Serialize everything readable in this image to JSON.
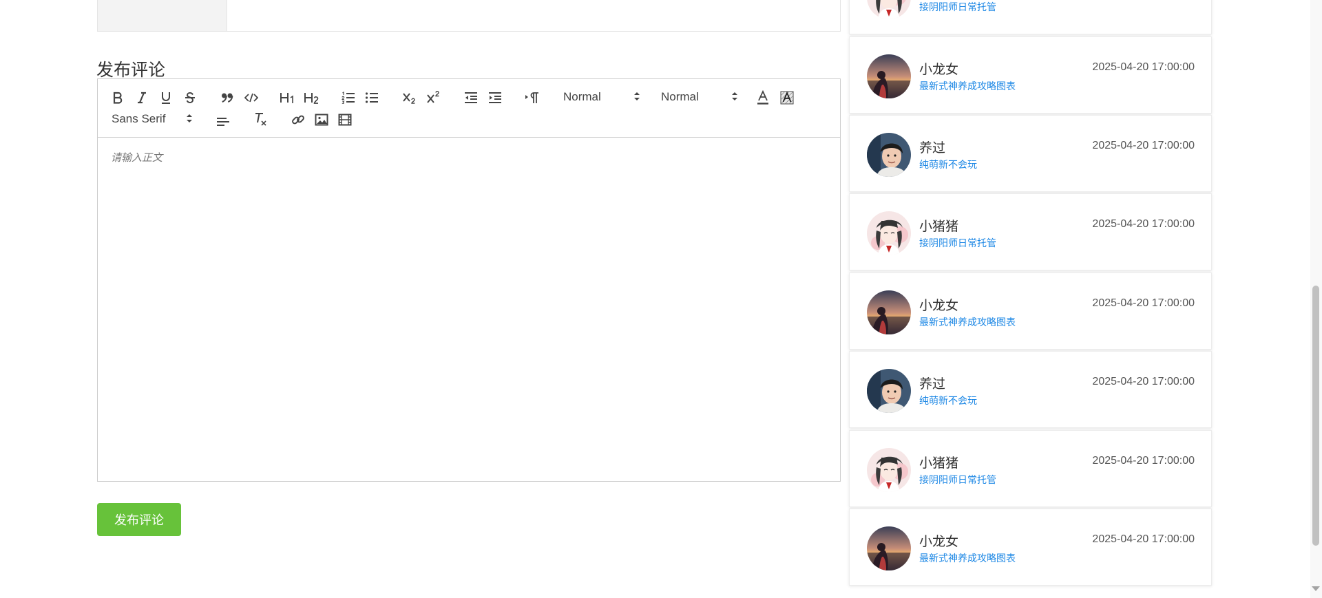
{
  "comment_section": {
    "title": "发布评论",
    "placeholder": "请输入正文",
    "submit_label": "发布评论",
    "toolbar": {
      "header_picker": "Normal",
      "size_picker": "Normal",
      "font_picker": "Sans Serif"
    }
  },
  "sidebar": {
    "partial_item": {
      "game": "接阴阳师日常托管",
      "avatar_icon": "anime-girl-avatar"
    },
    "items": [
      {
        "name": "小龙女",
        "game": "最新式神养成攻略图表",
        "time": "2025-04-20 17:00:00",
        "avatar_icon": "sunset-avatar"
      },
      {
        "name": "养过",
        "game": "纯萌新不会玩",
        "time": "2025-04-20 17:00:00",
        "avatar_icon": "man-avatar"
      },
      {
        "name": "小猪猪",
        "game": "接阴阳师日常托管",
        "time": "2025-04-20 17:00:00",
        "avatar_icon": "anime-girl-avatar"
      },
      {
        "name": "小龙女",
        "game": "最新式神养成攻略图表",
        "time": "2025-04-20 17:00:00",
        "avatar_icon": "sunset-avatar"
      },
      {
        "name": "养过",
        "game": "纯萌新不会玩",
        "time": "2025-04-20 17:00:00",
        "avatar_icon": "man-avatar"
      },
      {
        "name": "小猪猪",
        "game": "接阴阳师日常托管",
        "time": "2025-04-20 17:00:00",
        "avatar_icon": "anime-girl-avatar"
      },
      {
        "name": "小龙女",
        "game": "最新式神养成攻略图表",
        "time": "2025-04-20 17:00:00",
        "avatar_icon": "sunset-avatar"
      }
    ]
  },
  "colors": {
    "accent_green": "#67c23a",
    "link_blue": "#1e88e5"
  }
}
